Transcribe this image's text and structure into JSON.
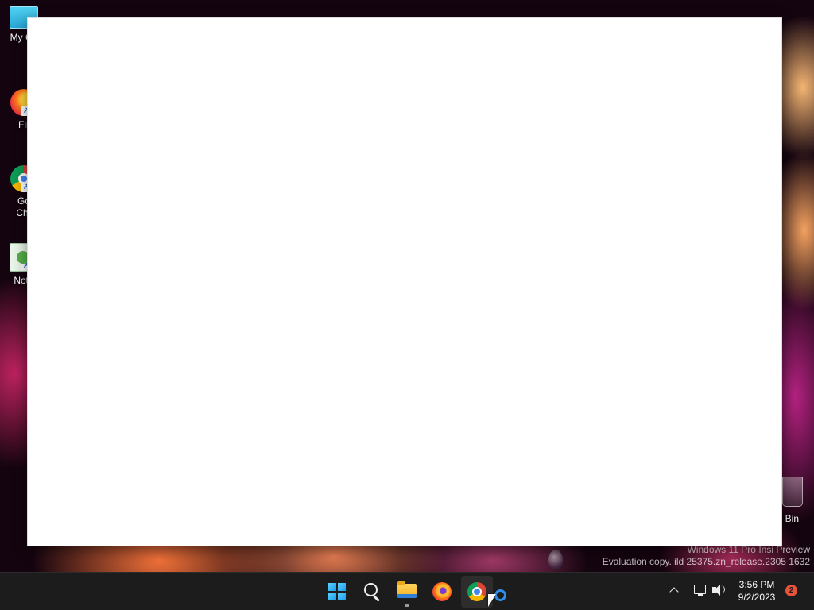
{
  "desktop": {
    "icons": [
      {
        "label": "My Co",
        "icon": "monitor-icon"
      },
      {
        "label": "Fir",
        "icon": "firefox-icon"
      },
      {
        "label": "Go\nChr",
        "icon": "chrome-icon"
      },
      {
        "label": "Note",
        "icon": "notepad-icon"
      }
    ],
    "recycle_bin": {
      "label": "Bin",
      "icon": "recycle-bin-icon"
    },
    "watermark": {
      "line1": "Windows 11 Pro Insi   Preview",
      "line2": "Evaluation copy.   ild 25375.zn_release.2305  1632"
    }
  },
  "window": {
    "content": ""
  },
  "taskbar": {
    "apps": [
      {
        "name": "Start",
        "icon": "windows-start-icon"
      },
      {
        "name": "Search",
        "icon": "search-icon"
      },
      {
        "name": "File Explorer",
        "icon": "folder-icon"
      },
      {
        "name": "Firefox",
        "icon": "firefox-icon"
      },
      {
        "name": "Google Chrome",
        "icon": "chrome-icon"
      }
    ],
    "tray": {
      "chevron_icon": "chevron-up-icon",
      "network_icon": "network-icon",
      "volume_icon": "volume-icon",
      "time": "3:56 PM",
      "date": "9/2/2023",
      "notification_count": "2"
    }
  },
  "colors": {
    "taskbar_bg": "#1c1c1c",
    "window_bg": "#ffffff",
    "notification_badge": "#e6533a",
    "accent_blue": "#1a9ef0"
  }
}
